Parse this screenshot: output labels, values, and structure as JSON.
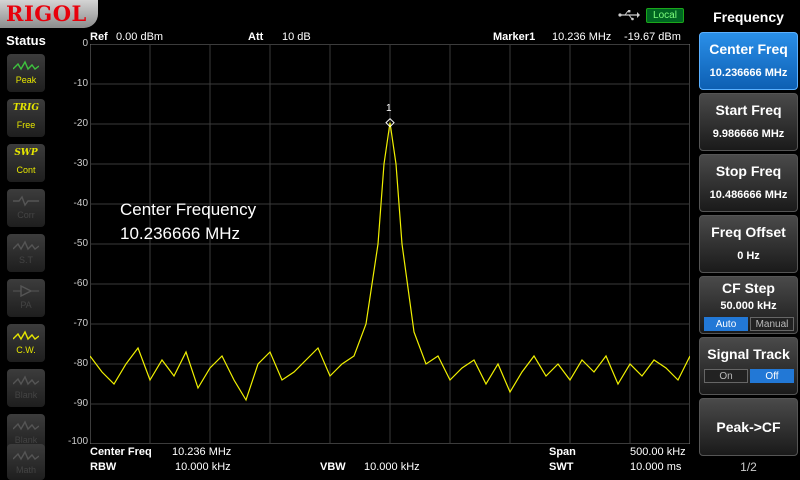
{
  "brand": "RIGOL",
  "remote_status": "Local",
  "status": {
    "title": "Status",
    "items": [
      {
        "small": "",
        "label": "Peak",
        "state": "active"
      },
      {
        "small": "TRIG",
        "label": "Free",
        "state": "active"
      },
      {
        "small": "SWP",
        "label": "Cont",
        "state": "active"
      },
      {
        "small": "",
        "label": "Corr",
        "state": "dim"
      },
      {
        "small": "",
        "label": "S.T",
        "state": "dim"
      },
      {
        "small": "",
        "label": "PA",
        "state": "dim"
      },
      {
        "small": "",
        "label": "C.W.",
        "state": "active"
      },
      {
        "small": "",
        "label": "Blank",
        "state": "dim"
      },
      {
        "small": "",
        "label": "Blank",
        "state": "dim"
      },
      {
        "small": "",
        "label": "Math",
        "state": "dim"
      }
    ]
  },
  "header": {
    "ref_label": "Ref",
    "ref_value": "0.00 dBm",
    "att_label": "Att",
    "att_value": "10 dB",
    "marker_label": "Marker1",
    "marker_freq": "10.236 MHz",
    "marker_ampl": "-19.67 dBm"
  },
  "y_tick_labels": [
    "0",
    "-10",
    "-20",
    "-30",
    "-40",
    "-50",
    "-60",
    "-70",
    "-80",
    "-90",
    "-100"
  ],
  "overlay": {
    "line1": "Center Frequency",
    "line2": "10.236666 MHz"
  },
  "marker_number": "1",
  "footer": {
    "center_label": "Center Freq",
    "center_value": "10.236 MHz",
    "span_label": "Span",
    "span_value": "500.00 kHz",
    "rbw_label": "RBW",
    "rbw_value": "10.000 kHz",
    "vbw_label": "VBW",
    "vbw_value": "10.000 kHz",
    "swt_label": "SWT",
    "swt_value": "10.000 ms"
  },
  "menu": {
    "title": "Frequency",
    "center_freq": {
      "label": "Center Freq",
      "value": "10.236666 MHz"
    },
    "start_freq": {
      "label": "Start Freq",
      "value": "9.986666 MHz"
    },
    "stop_freq": {
      "label": "Stop Freq",
      "value": "10.486666 MHz"
    },
    "freq_offset": {
      "label": "Freq Offset",
      "value": "0 Hz"
    },
    "cf_step": {
      "label": "CF Step",
      "value": "50.000 kHz",
      "auto": "Auto",
      "manual": "Manual",
      "selected": "Auto"
    },
    "signal_track": {
      "label": "Signal Track",
      "on": "On",
      "off": "Off",
      "selected": "Off"
    },
    "peak_cf": {
      "label": "Peak->CF"
    },
    "page": "1/2"
  },
  "colors": {
    "trace": "#f0f000",
    "grid": "#3a3a3a",
    "selected": "#1a7fe0"
  },
  "chart_data": {
    "type": "line",
    "xlabel": "",
    "ylabel": "",
    "xlim_mhz": [
      9.986666,
      10.486666
    ],
    "ylim": [
      -100,
      0
    ],
    "grid": true,
    "series": [
      {
        "x": [
          9.9867,
          9.9967,
          10.0067,
          10.0167,
          10.0267,
          10.0367,
          10.0467,
          10.0567,
          10.0667,
          10.0767,
          10.0867,
          10.0967,
          10.1067,
          10.1167,
          10.1267,
          10.1367,
          10.1467,
          10.1567,
          10.1667,
          10.1767,
          10.1867,
          10.1967,
          10.2067,
          10.2167,
          10.2267,
          10.2317,
          10.2367,
          10.2417,
          10.2467,
          10.2567,
          10.2667,
          10.2767,
          10.2867,
          10.2967,
          10.3067,
          10.3167,
          10.3267,
          10.3367,
          10.3467,
          10.3567,
          10.3667,
          10.3767,
          10.3867,
          10.3967,
          10.4067,
          10.4167,
          10.4267,
          10.4367,
          10.4467,
          10.4567,
          10.4667,
          10.4767,
          10.4867
        ],
        "y": [
          -78,
          -82,
          -85,
          -80,
          -76,
          -84,
          -79,
          -83,
          -77,
          -86,
          -81,
          -78,
          -84,
          -89,
          -80,
          -77,
          -84,
          -82,
          -79,
          -76,
          -83,
          -80,
          -78,
          -70,
          -50,
          -30,
          -19.67,
          -30,
          -50,
          -72,
          -80,
          -78,
          -84,
          -81,
          -79,
          -85,
          -80,
          -87,
          -82,
          -78,
          -83,
          -80,
          -84,
          -79,
          -82,
          -78,
          -85,
          -80,
          -83,
          -79,
          -81,
          -84,
          -78
        ]
      }
    ]
  }
}
